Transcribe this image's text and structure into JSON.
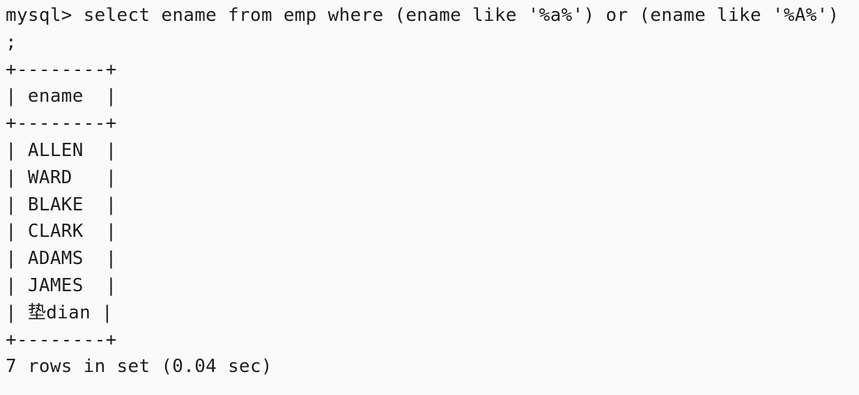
{
  "terminal": {
    "prompt": "mysql> ",
    "command_line1": "select ename from emp where (ename like '%a%') or (ename like '%A%')",
    "command_line2": ";",
    "border": "+--------+",
    "header_row": "| ename  |",
    "rows": [
      "| ALLEN  |",
      "| WARD   |",
      "| BLAKE  |",
      "| CLARK  |",
      "| ADAMS  |",
      "| JAMES  |",
      "| 垫dian |"
    ],
    "result_summary": "7 rows in set (0.04 sec)"
  }
}
